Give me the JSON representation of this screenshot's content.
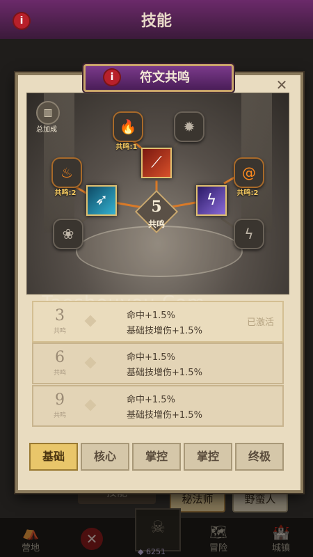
{
  "app": {
    "title": "技能"
  },
  "background": {
    "skill_button": "技能",
    "class_tabs": [
      "秘法师",
      "野蛮人"
    ],
    "nav": [
      {
        "label": "营地",
        "icon": "tent-icon"
      },
      {
        "label": "",
        "icon": "close-icon"
      },
      {
        "label": "6251",
        "icon": "gem-icon"
      },
      {
        "label": "冒险",
        "icon": "map-icon"
      },
      {
        "label": "城镇",
        "icon": "castle-icon"
      }
    ]
  },
  "modal": {
    "title": "符文共鸣",
    "total_bonus": {
      "label": "总加成",
      "icon": "bar-chart-icon"
    },
    "resonance": {
      "count": "5",
      "label": "共鸣"
    },
    "slots": [
      {
        "name": "fire-rune-top",
        "icon": "flame-icon",
        "label": "共鸣:1",
        "active": true
      },
      {
        "name": "burst-rune-top",
        "icon": "burst-icon",
        "label": "",
        "active": false
      },
      {
        "name": "fire-rune-left",
        "icon": "fire-swirl-icon",
        "label": "共鸣:2",
        "active": true
      },
      {
        "name": "swirl-rune-right",
        "icon": "swirl-icon",
        "label": "共鸣:2",
        "active": true
      },
      {
        "name": "flower-rune-bottom",
        "icon": "flower-icon",
        "label": "",
        "active": false
      },
      {
        "name": "bolt-rune-bottom",
        "icon": "lightning-icon",
        "label": "",
        "active": false
      }
    ],
    "skills": [
      {
        "name": "fire-slash-skill",
        "icon": "slash-icon",
        "color": "#b8321e"
      },
      {
        "name": "ice-arrow-skill",
        "icon": "arrow-icon",
        "color": "#1e8aa8"
      },
      {
        "name": "lightning-skill",
        "icon": "lightning-icon",
        "color": "#5a3aa8"
      }
    ],
    "tiers": [
      {
        "level": "3",
        "sub": "共鸣",
        "line1": "命中+1.5%",
        "line2": "基础技增伤+1.5%",
        "status": "已激活"
      },
      {
        "level": "6",
        "sub": "共鸣",
        "line1": "命中+1.5%",
        "line2": "基础技增伤+1.5%",
        "status": ""
      },
      {
        "level": "9",
        "sub": "共鸣",
        "line1": "命中+1.5%",
        "line2": "基础技增伤+1.5%",
        "status": ""
      }
    ],
    "tabs": [
      "基础",
      "核心",
      "掌控",
      "掌控",
      "终极"
    ],
    "selected_tab": "基础"
  },
  "watermark": "Taoshouyou.Com",
  "colors": {
    "accent": "#e9c66a",
    "title_plate": "#5a2468",
    "link_line": "#d97a28"
  }
}
